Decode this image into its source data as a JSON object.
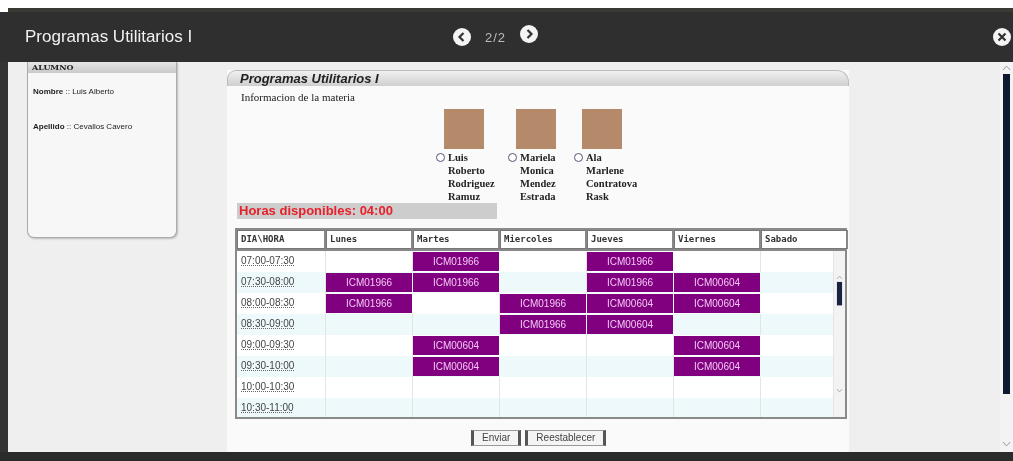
{
  "window": {
    "title": "Programas Utilitarios I",
    "pager": "2/2"
  },
  "student_panel": {
    "heading": "ALUMNO",
    "fields": [
      "**Nombre** :: Luis Alberto",
      "**Apellido** :: Cevallos Cavero"
    ]
  },
  "subject": {
    "title": "Programas Utilitarios I",
    "info": "Informacion de la materia",
    "professors": [
      {
        "name": "Luis Roberto Rodriguez Ramuz",
        "selected": false
      },
      {
        "name": "Mariela Monica Mendez Estrada",
        "selected": false
      },
      {
        "name": "Ala Marlene Contratova Rask",
        "selected": false
      }
    ],
    "hours": "Horas disponibles: 04:00"
  },
  "schedule": {
    "columns": [
      "DIA\\HORA",
      "Lunes",
      "Martes",
      "Miercoles",
      "Jueves",
      "Viernes",
      "Sabado"
    ],
    "rows": [
      {
        "cells": [
          "07:00-07:30",
          "",
          "ICM01966",
          "",
          "ICM01966",
          "",
          ""
        ]
      },
      {
        "cells": [
          "07:30-08:00",
          "ICM01966",
          "ICM01966",
          "",
          "ICM01966",
          "ICM00604",
          ""
        ]
      },
      {
        "cells": [
          "08:00-08:30",
          "ICM01966",
          "",
          "ICM01966",
          "ICM00604",
          "ICM00604",
          ""
        ]
      },
      {
        "cells": [
          "08:30-09:00",
          "",
          "",
          "ICM01966",
          "ICM00604",
          "",
          ""
        ]
      },
      {
        "cells": [
          "09:00-09:30",
          "",
          "ICM00604",
          "",
          "",
          "ICM00604",
          ""
        ]
      },
      {
        "cells": [
          "09:30-10:00",
          "",
          "ICM00604",
          "",
          "",
          "ICM00604",
          ""
        ]
      },
      {
        "cells": [
          "10:00-10:30",
          "",
          "",
          "",
          "",
          "",
          ""
        ]
      },
      {
        "cells": [
          "10:30-11:00",
          "",
          "",
          "",
          "",
          "",
          ""
        ]
      }
    ]
  },
  "buttons": [
    "Enviar",
    "Reestablecer"
  ]
}
